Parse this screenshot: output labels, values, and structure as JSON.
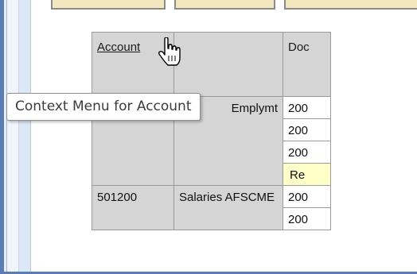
{
  "table": {
    "headers": {
      "account": "Account",
      "document": "Doc"
    },
    "rows": [
      {
        "account": "",
        "description": "Emplymt",
        "doc": "200",
        "type": "group-start"
      },
      {
        "doc": "200"
      },
      {
        "doc": "200"
      },
      {
        "doc": "Re",
        "highlight": true
      },
      {
        "account": "501200",
        "description": "Salaries AFSCME",
        "doc": "200",
        "type": "group-start"
      },
      {
        "doc": "200"
      }
    ]
  },
  "tooltip": {
    "text": "Context Menu for Account"
  },
  "cursor": {
    "icon": "hand-pointer-icon"
  },
  "colors": {
    "grid_background": "#d5d5d5",
    "highlight_cell": "#ffffc8",
    "frame_accent": "#5b7db5",
    "toolbar_button": "#f3e7bd"
  }
}
